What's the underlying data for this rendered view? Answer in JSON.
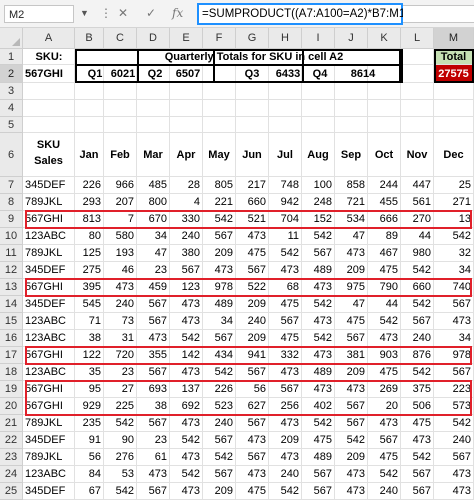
{
  "formula_bar": {
    "name_box": "M2",
    "cancel_icon": "✕",
    "enter_icon": "✓",
    "fx_label": "fx",
    "formula": "=SUMPRODUCT((A7:A100=A2)*B7:M100)"
  },
  "columns": [
    "A",
    "B",
    "C",
    "D",
    "E",
    "F",
    "G",
    "H",
    "I",
    "J",
    "K",
    "L",
    "M"
  ],
  "selected_column": "M",
  "selected_row": "2",
  "row_numbers": [
    "1",
    "2",
    "3",
    "4",
    "5",
    "6",
    "7",
    "8",
    "9",
    "10",
    "11",
    "12",
    "13",
    "14",
    "15",
    "16",
    "17",
    "18",
    "19",
    "20",
    "21",
    "22",
    "23",
    "24",
    "25"
  ],
  "header_block": {
    "sku_label": "SKU:",
    "sku_value": "567GHI",
    "title": "Quarterly Totals for SKU in cell A2",
    "quarters": [
      {
        "label": "Q1",
        "value": "6021"
      },
      {
        "label": "Q2",
        "value": "6507"
      },
      {
        "label": "Q3",
        "value": "6433"
      },
      {
        "label": "Q4",
        "value": "8614"
      }
    ],
    "total_label": "Total",
    "total_value": "27575",
    "total_color": "#c00000"
  },
  "table": {
    "sku_header_line1": "SKU",
    "sku_header_line2": "Sales",
    "months": [
      "Jan",
      "Feb",
      "Mar",
      "Apr",
      "May",
      "Jun",
      "Jul",
      "Aug",
      "Sep",
      "Oct",
      "Nov",
      "Dec"
    ],
    "rows": [
      {
        "sku": "345DEF",
        "values": [
          "226",
          "966",
          "485",
          "28",
          "805",
          "217",
          "748",
          "100",
          "858",
          "244",
          "447",
          "25"
        ]
      },
      {
        "sku": "789JKL",
        "values": [
          "293",
          "207",
          "800",
          "4",
          "221",
          "660",
          "942",
          "248",
          "721",
          "455",
          "561",
          "271"
        ]
      },
      {
        "sku": "567GHI",
        "values": [
          "813",
          "7",
          "670",
          "330",
          "542",
          "521",
          "704",
          "152",
          "534",
          "666",
          "270",
          "13"
        ]
      },
      {
        "sku": "123ABC",
        "values": [
          "80",
          "580",
          "34",
          "240",
          "567",
          "473",
          "11",
          "542",
          "47",
          "89",
          "44",
          "542"
        ]
      },
      {
        "sku": "789JKL",
        "values": [
          "125",
          "193",
          "47",
          "380",
          "209",
          "475",
          "542",
          "567",
          "473",
          "467",
          "980",
          "32"
        ]
      },
      {
        "sku": "345DEF",
        "values": [
          "275",
          "46",
          "23",
          "567",
          "473",
          "567",
          "473",
          "489",
          "209",
          "475",
          "542",
          "34"
        ]
      },
      {
        "sku": "567GHI",
        "values": [
          "395",
          "473",
          "459",
          "123",
          "978",
          "522",
          "68",
          "473",
          "975",
          "790",
          "660",
          "740"
        ]
      },
      {
        "sku": "345DEF",
        "values": [
          "545",
          "240",
          "567",
          "473",
          "489",
          "209",
          "475",
          "542",
          "47",
          "44",
          "542",
          "567"
        ]
      },
      {
        "sku": "123ABC",
        "values": [
          "71",
          "73",
          "567",
          "473",
          "34",
          "240",
          "567",
          "473",
          "475",
          "542",
          "567",
          "473"
        ]
      },
      {
        "sku": "123ABC",
        "values": [
          "38",
          "31",
          "473",
          "542",
          "567",
          "209",
          "475",
          "542",
          "567",
          "473",
          "240",
          "34"
        ]
      },
      {
        "sku": "567GHI",
        "values": [
          "122",
          "720",
          "355",
          "142",
          "434",
          "941",
          "332",
          "473",
          "381",
          "903",
          "876",
          "978"
        ]
      },
      {
        "sku": "123ABC",
        "values": [
          "35",
          "23",
          "567",
          "473",
          "542",
          "567",
          "473",
          "489",
          "209",
          "475",
          "542",
          "567"
        ]
      },
      {
        "sku": "567GHI",
        "values": [
          "95",
          "27",
          "693",
          "137",
          "226",
          "56",
          "567",
          "473",
          "473",
          "269",
          "375",
          "223"
        ]
      },
      {
        "sku": "567GHI",
        "values": [
          "929",
          "225",
          "38",
          "692",
          "523",
          "627",
          "256",
          "402",
          "567",
          "20",
          "506",
          "573"
        ]
      },
      {
        "sku": "789JKL",
        "values": [
          "235",
          "542",
          "567",
          "473",
          "240",
          "567",
          "473",
          "542",
          "567",
          "473",
          "475",
          "542"
        ]
      },
      {
        "sku": "345DEF",
        "values": [
          "91",
          "90",
          "23",
          "542",
          "567",
          "473",
          "209",
          "475",
          "542",
          "567",
          "473",
          "240"
        ]
      },
      {
        "sku": "789JKL",
        "values": [
          "56",
          "276",
          "61",
          "473",
          "542",
          "567",
          "473",
          "489",
          "209",
          "475",
          "542",
          "567"
        ]
      },
      {
        "sku": "123ABC",
        "values": [
          "84",
          "53",
          "473",
          "542",
          "567",
          "473",
          "240",
          "567",
          "473",
          "542",
          "567",
          "473"
        ]
      },
      {
        "sku": "345DEF",
        "values": [
          "67",
          "542",
          "567",
          "473",
          "209",
          "475",
          "542",
          "567",
          "473",
          "240",
          "567",
          "473"
        ]
      }
    ]
  }
}
